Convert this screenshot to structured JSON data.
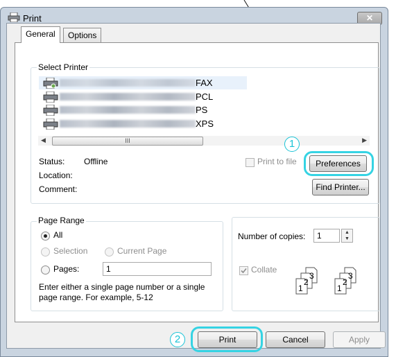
{
  "window": {
    "title": "Print",
    "close_label": "✕"
  },
  "tabs": [
    {
      "label": "General"
    },
    {
      "label": "Options"
    }
  ],
  "select_printer": {
    "group_label": "Select Printer",
    "printers": [
      {
        "suffix": "FAX"
      },
      {
        "suffix": "PCL"
      },
      {
        "suffix": "PS"
      },
      {
        "suffix": "XPS"
      }
    ],
    "scroll_thumb": "III",
    "status_label": "Status:",
    "status_value": "Offline",
    "location_label": "Location:",
    "comment_label": "Comment:",
    "print_to_file_label": "Print to file",
    "preferences_label": "Preferences",
    "find_printer_label": "Find Printer..."
  },
  "page_range": {
    "group_label": "Page Range",
    "all_label": "All",
    "selection_label": "Selection",
    "current_page_label": "Current Page",
    "pages_label": "Pages:",
    "pages_value": "1",
    "hint": "Enter either a single page number or a single page range.  For example, 5-12"
  },
  "copies": {
    "label": "Number of copies:",
    "value": "1",
    "collate_label": "Collate",
    "collate_pages": [
      "1",
      "2",
      "3"
    ]
  },
  "buttons": {
    "print": "Print",
    "cancel": "Cancel",
    "apply": "Apply"
  },
  "callouts": {
    "one": "1",
    "two": "2"
  },
  "colors": {
    "highlight": "#35d3e3",
    "callout": "#18c3d6"
  }
}
